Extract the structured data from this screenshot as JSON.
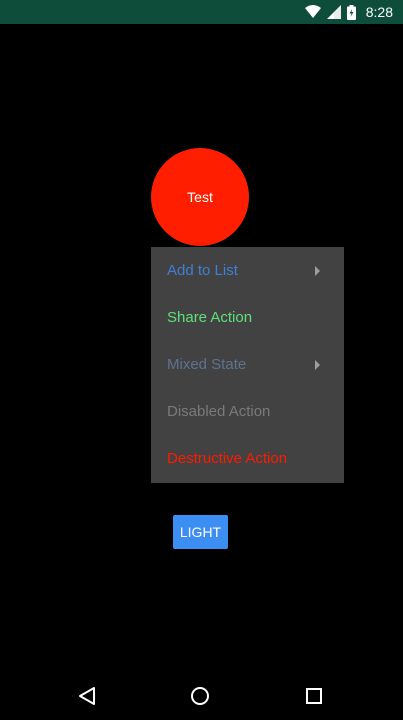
{
  "status_bar": {
    "time": "8:28"
  },
  "circle": {
    "label": "Test",
    "color": "#ff1f00"
  },
  "menu": {
    "items": [
      {
        "label": "Add to List",
        "color": "#3f7fd6",
        "has_submenu": true
      },
      {
        "label": "Share Action",
        "color": "#5fe07a",
        "has_submenu": false
      },
      {
        "label": "Mixed State",
        "color": "#5e7390",
        "has_submenu": true
      },
      {
        "label": "Disabled Action",
        "color": "#7a7a7a",
        "has_submenu": false
      },
      {
        "label": "Destructive Action",
        "color": "#ff1a00",
        "has_submenu": false
      }
    ]
  },
  "light_button": {
    "label": "LIGHT",
    "color": "#3d8ef2"
  },
  "nav": {
    "icons": [
      "back-icon",
      "home-icon",
      "recents-icon"
    ]
  }
}
